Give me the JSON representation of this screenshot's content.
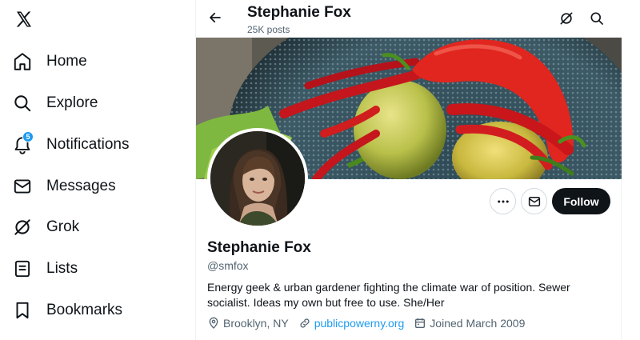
{
  "nav": {
    "items": [
      {
        "label": "Home",
        "icon": "home-icon"
      },
      {
        "label": "Explore",
        "icon": "search-icon"
      },
      {
        "label": "Notifications",
        "icon": "bell-icon",
        "badge": "5"
      },
      {
        "label": "Messages",
        "icon": "envelope-icon"
      },
      {
        "label": "Grok",
        "icon": "grok-icon"
      },
      {
        "label": "Lists",
        "icon": "list-icon"
      },
      {
        "label": "Bookmarks",
        "icon": "bookmark-icon"
      }
    ]
  },
  "header": {
    "title": "Stephanie Fox",
    "subtitle": "25K posts"
  },
  "profile": {
    "name": "Stephanie Fox",
    "handle": "@smfox",
    "bio": "Energy geek & urban gardener fighting the climate war of position. Sewer socialist. Ideas my own but free to use. She/Her",
    "location": "Brooklyn, NY",
    "website": "publicpowerny.org",
    "joined": "Joined March 2009",
    "follow_label": "Follow"
  },
  "colors": {
    "accent": "#1d9bf0",
    "text": "#0f1419",
    "muted": "#536471",
    "follow_bg": "#0f1419"
  }
}
